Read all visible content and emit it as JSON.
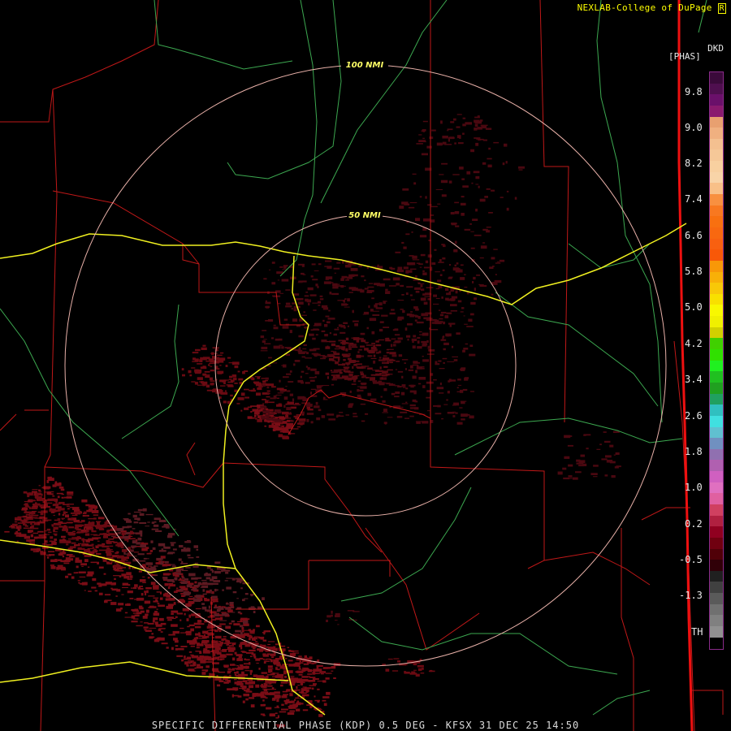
{
  "header": {
    "credit": "NEXLAB-College of DuPage",
    "credit_mark": "R"
  },
  "legend": {
    "product_code": "DKD",
    "unit": "[PHAS]",
    "ticks": [
      "9.8",
      "9.0",
      "8.2",
      "7.4",
      "6.6",
      "5.8",
      "5.0",
      "4.2",
      "3.4",
      "2.6",
      "1.8",
      "1.0",
      "0.2",
      "-0.5",
      "-1.3",
      "TH"
    ],
    "colors": [
      "#3a0a3a",
      "#4f0f4f",
      "#6a106a",
      "#8a1a6e",
      "#e8a070",
      "#f0b080",
      "#f4c090",
      "#f6c898",
      "#f8d0a0",
      "#f8d4a8",
      "#f8c088",
      "#f89040",
      "#f87820",
      "#f87010",
      "#f86810",
      "#f86010",
      "#f85808",
      "#f89808",
      "#f8b008",
      "#f8c808",
      "#f8e000",
      "#f8f800",
      "#f0f000",
      "#d0d000",
      "#40d000",
      "#30e000",
      "#20f020",
      "#20c020",
      "#20a020",
      "#20a060",
      "#30c0c0",
      "#40e0e0",
      "#60c0d0",
      "#7090c0",
      "#9070b0",
      "#b060b0",
      "#d060c0",
      "#e070c0",
      "#e060a0",
      "#d04060",
      "#b02040",
      "#900020",
      "#700010",
      "#500008",
      "#300008",
      "#202020",
      "#404040",
      "#5a5a5a",
      "#707070",
      "#808080",
      "#909090",
      "#000000"
    ]
  },
  "map": {
    "range_labels": [
      "100 NMI",
      "50 NMI"
    ]
  },
  "footer": {
    "caption": "SPECIFIC DIFFERENTIAL PHASE (KDP) 0.5 DEG - KFSX 31 DEC 25 14:50"
  }
}
